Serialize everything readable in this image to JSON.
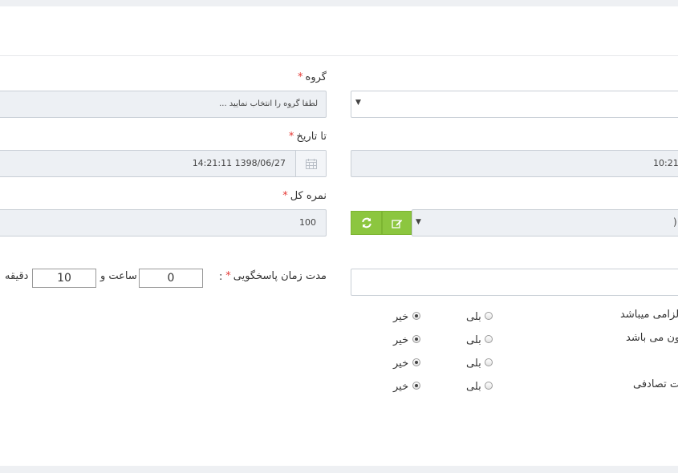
{
  "form": {
    "group": {
      "label": "گروه",
      "required_mark": "*",
      "placeholder_value": "لطفا گروه را انتخاب نمایید ..."
    },
    "to_date": {
      "label": "تا تاریخ",
      "required_mark": "*",
      "value": "14:21:11 1398/06/27"
    },
    "from_date_partial": "10:21:",
    "total_score": {
      "label": "نمره کل",
      "required_mark": "*",
      "value": "100"
    },
    "select_partial_right_text": ")",
    "response_time": {
      "label": "مدت زمان پاسخگویی",
      "required_mark": "*",
      "colon": ":",
      "hours_value": "0",
      "hours_suffix": "ساعت و",
      "minutes_value": "10",
      "minutes_suffix": "دقیقه"
    },
    "options": [
      {
        "label": "لزامی میباشد",
        "yes": "بلی",
        "no": "خیر",
        "selected": "no"
      },
      {
        "label": "ون می باشد",
        "yes": "بلی",
        "no": "خیر",
        "selected": "no"
      },
      {
        "label": "",
        "yes": "بلی",
        "no": "خیر",
        "selected": "no"
      },
      {
        "label": "ت تصادفی",
        "yes": "بلی",
        "no": "خیر",
        "selected": "no"
      }
    ]
  },
  "colors": {
    "accent_green": "#8cc63f",
    "required_red": "#e53935",
    "field_bg": "#edf0f4"
  }
}
